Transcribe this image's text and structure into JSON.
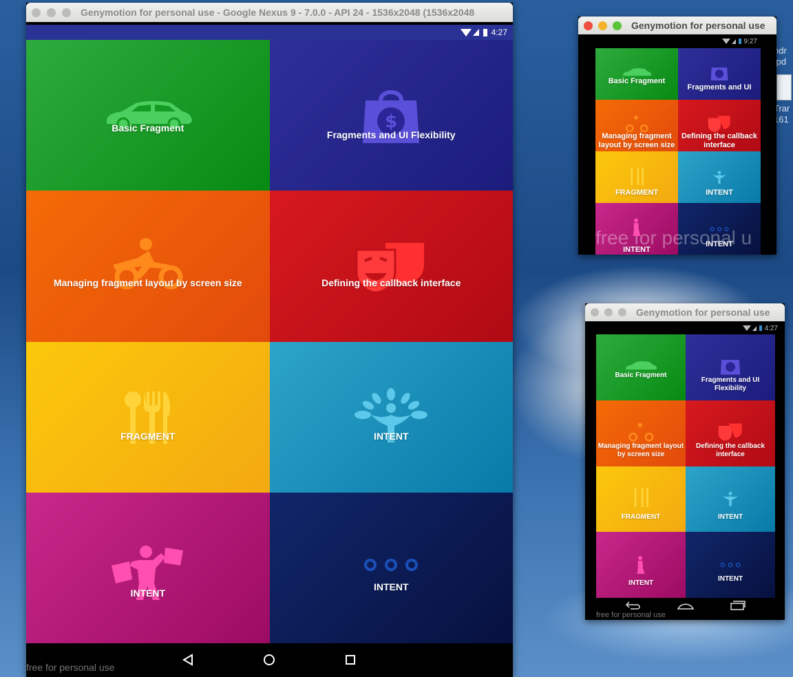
{
  "main_window": {
    "title": "Genymotion for personal use - Google Nexus 9 - 7.0.0 - API 24 - 1536x2048 (1536x2048",
    "status_time": "4:27",
    "watermark": "free for personal use",
    "tiles": [
      {
        "label": "Basic Fragment",
        "icon": "car-icon"
      },
      {
        "label": "Fragments and UI Flexibility",
        "icon": "shopping-bag-dollar-icon"
      },
      {
        "label": "Managing fragment layout by screen size",
        "icon": "cyclist-icon"
      },
      {
        "label": "Defining the callback interface",
        "icon": "theater-masks-icon"
      },
      {
        "label": "FRAGMENT",
        "icon": "cutlery-icon"
      },
      {
        "label": "INTENT",
        "icon": "tree-person-icon"
      },
      {
        "label": "INTENT",
        "icon": "shopper-icon"
      },
      {
        "label": "INTENT",
        "icon": "three-dots-icon"
      }
    ],
    "nav": {
      "back": "back-icon",
      "home": "home-icon",
      "recents": "recents-icon"
    }
  },
  "small_window_1": {
    "title": "Genymotion for personal use",
    "status_time": "9:27",
    "watermark": "free for personal u",
    "tiles": [
      {
        "label": "Basic Fragment"
      },
      {
        "label": "Fragments and UI"
      },
      {
        "label": "Managing fragment layout by screen size"
      },
      {
        "label": "Defining the callback interface"
      },
      {
        "label": "FRAGMENT"
      },
      {
        "label": "INTENT"
      },
      {
        "label": "INTENT"
      },
      {
        "label": "INTENT"
      }
    ]
  },
  "small_window_2": {
    "title": "Genymotion for personal use",
    "status_time": "4:27",
    "watermark": "free for personal use",
    "tiles": [
      {
        "label": "Basic Fragment"
      },
      {
        "label": "Fragments and UI Flexibility"
      },
      {
        "label": "Managing fragment layout by screen size"
      },
      {
        "label": "Defining the callback interface"
      },
      {
        "label": "FRAGMENT"
      },
      {
        "label": "INTENT"
      },
      {
        "label": "INTENT"
      },
      {
        "label": "INTENT"
      }
    ]
  },
  "desktop": {
    "file_fragments": [
      "ndr",
      ".pd",
      "Trar",
      "161"
    ]
  },
  "colors": {
    "green": "#129a22",
    "indigo": "#25258a",
    "orange": "#ee5c09",
    "red": "#c31119",
    "yellow": "#f7b90f",
    "cyan": "#1b8fb8",
    "pink": "#b21a77",
    "navy": "#0c1b55",
    "status_bar_main": "#2b3296",
    "titlebar_text": "#8a8a88"
  }
}
